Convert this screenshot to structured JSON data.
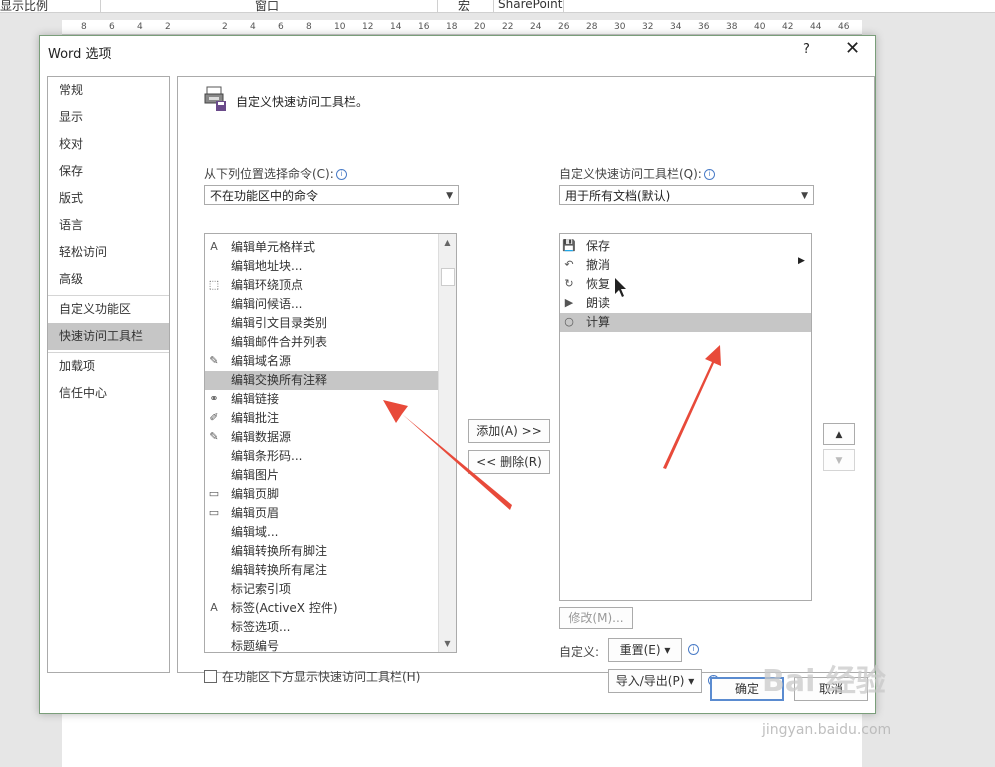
{
  "topbar": {
    "zoom_group": "显示比例",
    "window_group": "窗口",
    "macro_group": "宏",
    "sharepoint_group": "SharePoint"
  },
  "ruler": {
    "ticks": [
      "8",
      "6",
      "4",
      "2",
      "2",
      "4",
      "6",
      "8",
      "10",
      "12",
      "14",
      "16",
      "18",
      "20",
      "22",
      "24",
      "26",
      "28",
      "30",
      "32",
      "34",
      "36",
      "38",
      "40",
      "42",
      "44",
      "46"
    ]
  },
  "dialog": {
    "title": "Word 选项",
    "help": "?",
    "close": "✕",
    "nav": [
      "常规",
      "显示",
      "校对",
      "保存",
      "版式",
      "语言",
      "轻松访问",
      "高级",
      "自定义功能区",
      "快速访问工具栏",
      "加载项",
      "信任中心"
    ],
    "active_nav": "快速访问工具栏",
    "heading": "自定义快速访问工具栏。",
    "choose_label": "从下列位置选择命令(C):",
    "choose_value": "不在功能区中的命令",
    "customize_label": "自定义快速访问工具栏(Q):",
    "customize_value": "用于所有文档(默认)",
    "commands": [
      {
        "label": "编辑单元格样式",
        "icon": "A"
      },
      {
        "label": "编辑地址块...",
        "icon": ""
      },
      {
        "label": "编辑环绕顶点",
        "icon": "⬚"
      },
      {
        "label": "编辑问候语...",
        "icon": ""
      },
      {
        "label": "编辑引文目录类别",
        "icon": ""
      },
      {
        "label": "编辑邮件合并列表",
        "icon": ""
      },
      {
        "label": "编辑域名源",
        "icon": "✎"
      },
      {
        "label": "编辑交换所有注释",
        "icon": ""
      },
      {
        "label": "编辑链接",
        "icon": "⚭"
      },
      {
        "label": "编辑批注",
        "icon": "✐"
      },
      {
        "label": "编辑数据源",
        "icon": "✎"
      },
      {
        "label": "编辑条形码...",
        "icon": ""
      },
      {
        "label": "编辑图片",
        "icon": ""
      },
      {
        "label": "编辑页脚",
        "icon": "▭"
      },
      {
        "label": "编辑页眉",
        "icon": "▭"
      },
      {
        "label": "编辑域...",
        "icon": ""
      },
      {
        "label": "编辑转换所有脚注",
        "icon": ""
      },
      {
        "label": "编辑转换所有尾注",
        "icon": ""
      },
      {
        "label": "标记索引项",
        "icon": ""
      },
      {
        "label": "标签(ActiveX 控件)",
        "icon": "A"
      },
      {
        "label": "标签选项...",
        "icon": ""
      },
      {
        "label": "标题编号",
        "icon": ""
      }
    ],
    "selected_command": "编辑交换所有注释",
    "toolbar_items": [
      {
        "label": "保存",
        "icon": "💾"
      },
      {
        "label": "撤消",
        "icon": "↶"
      },
      {
        "label": "恢复",
        "icon": "↻"
      },
      {
        "label": "朗读",
        "icon": "▶"
      },
      {
        "label": "计算",
        "icon": "○"
      }
    ],
    "selected_toolbar": "计算",
    "add_button": "添加(A) >>",
    "remove_button": "<< 删除(R)",
    "modify_button": "修改(M)...",
    "customize_row_label": "自定义:",
    "reset_button": "重置(E) ▾",
    "import_export_button": "导入/导出(P) ▾",
    "show_below_checkbox": "在功能区下方显示快速访问工具栏(H)",
    "ok_button": "确定",
    "cancel_button": "取消",
    "up_arrow": "▲",
    "down_arrow": "▼"
  },
  "watermark": {
    "brand": "Bai 经验",
    "url": "jingyan.baidu.com"
  }
}
